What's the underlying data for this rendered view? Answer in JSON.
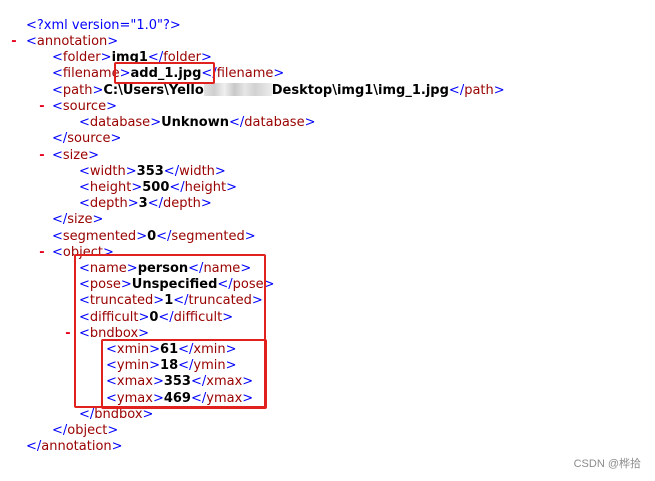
{
  "declaration": "<?xml version=\"1.0\"?>",
  "tags": {
    "annotation": "annotation",
    "folder": "folder",
    "filename": "filename",
    "path": "path",
    "source": "source",
    "database": "database",
    "size": "size",
    "width": "width",
    "height": "height",
    "depth": "depth",
    "segmented": "segmented",
    "object": "object",
    "name": "name",
    "pose": "pose",
    "truncated": "truncated",
    "difficult": "difficult",
    "bndbox": "bndbox",
    "xmin": "xmin",
    "ymin": "ymin",
    "xmax": "xmax",
    "ymax": "ymax"
  },
  "values": {
    "folder": "img1",
    "filename": "add_1.jpg",
    "path_start": "C:\\Users\\Yello",
    "path_end": "Desktop\\img1\\img_1.jpg",
    "database": "Unknown",
    "width": "353",
    "height": "500",
    "depth": "3",
    "segmented": "0",
    "name": "person",
    "pose": "Unspecified",
    "truncated": "1",
    "difficult": "0",
    "xmin": "61",
    "ymin": "18",
    "xmax": "353",
    "ymax": "469"
  },
  "collapse_marker": "-",
  "watermark": "CSDN @桦拾",
  "colors": {
    "bracket": "#0000ff",
    "tag": "#990000",
    "value": "#000000",
    "collapse": "#e8001c",
    "highlight": "#e0211d"
  }
}
